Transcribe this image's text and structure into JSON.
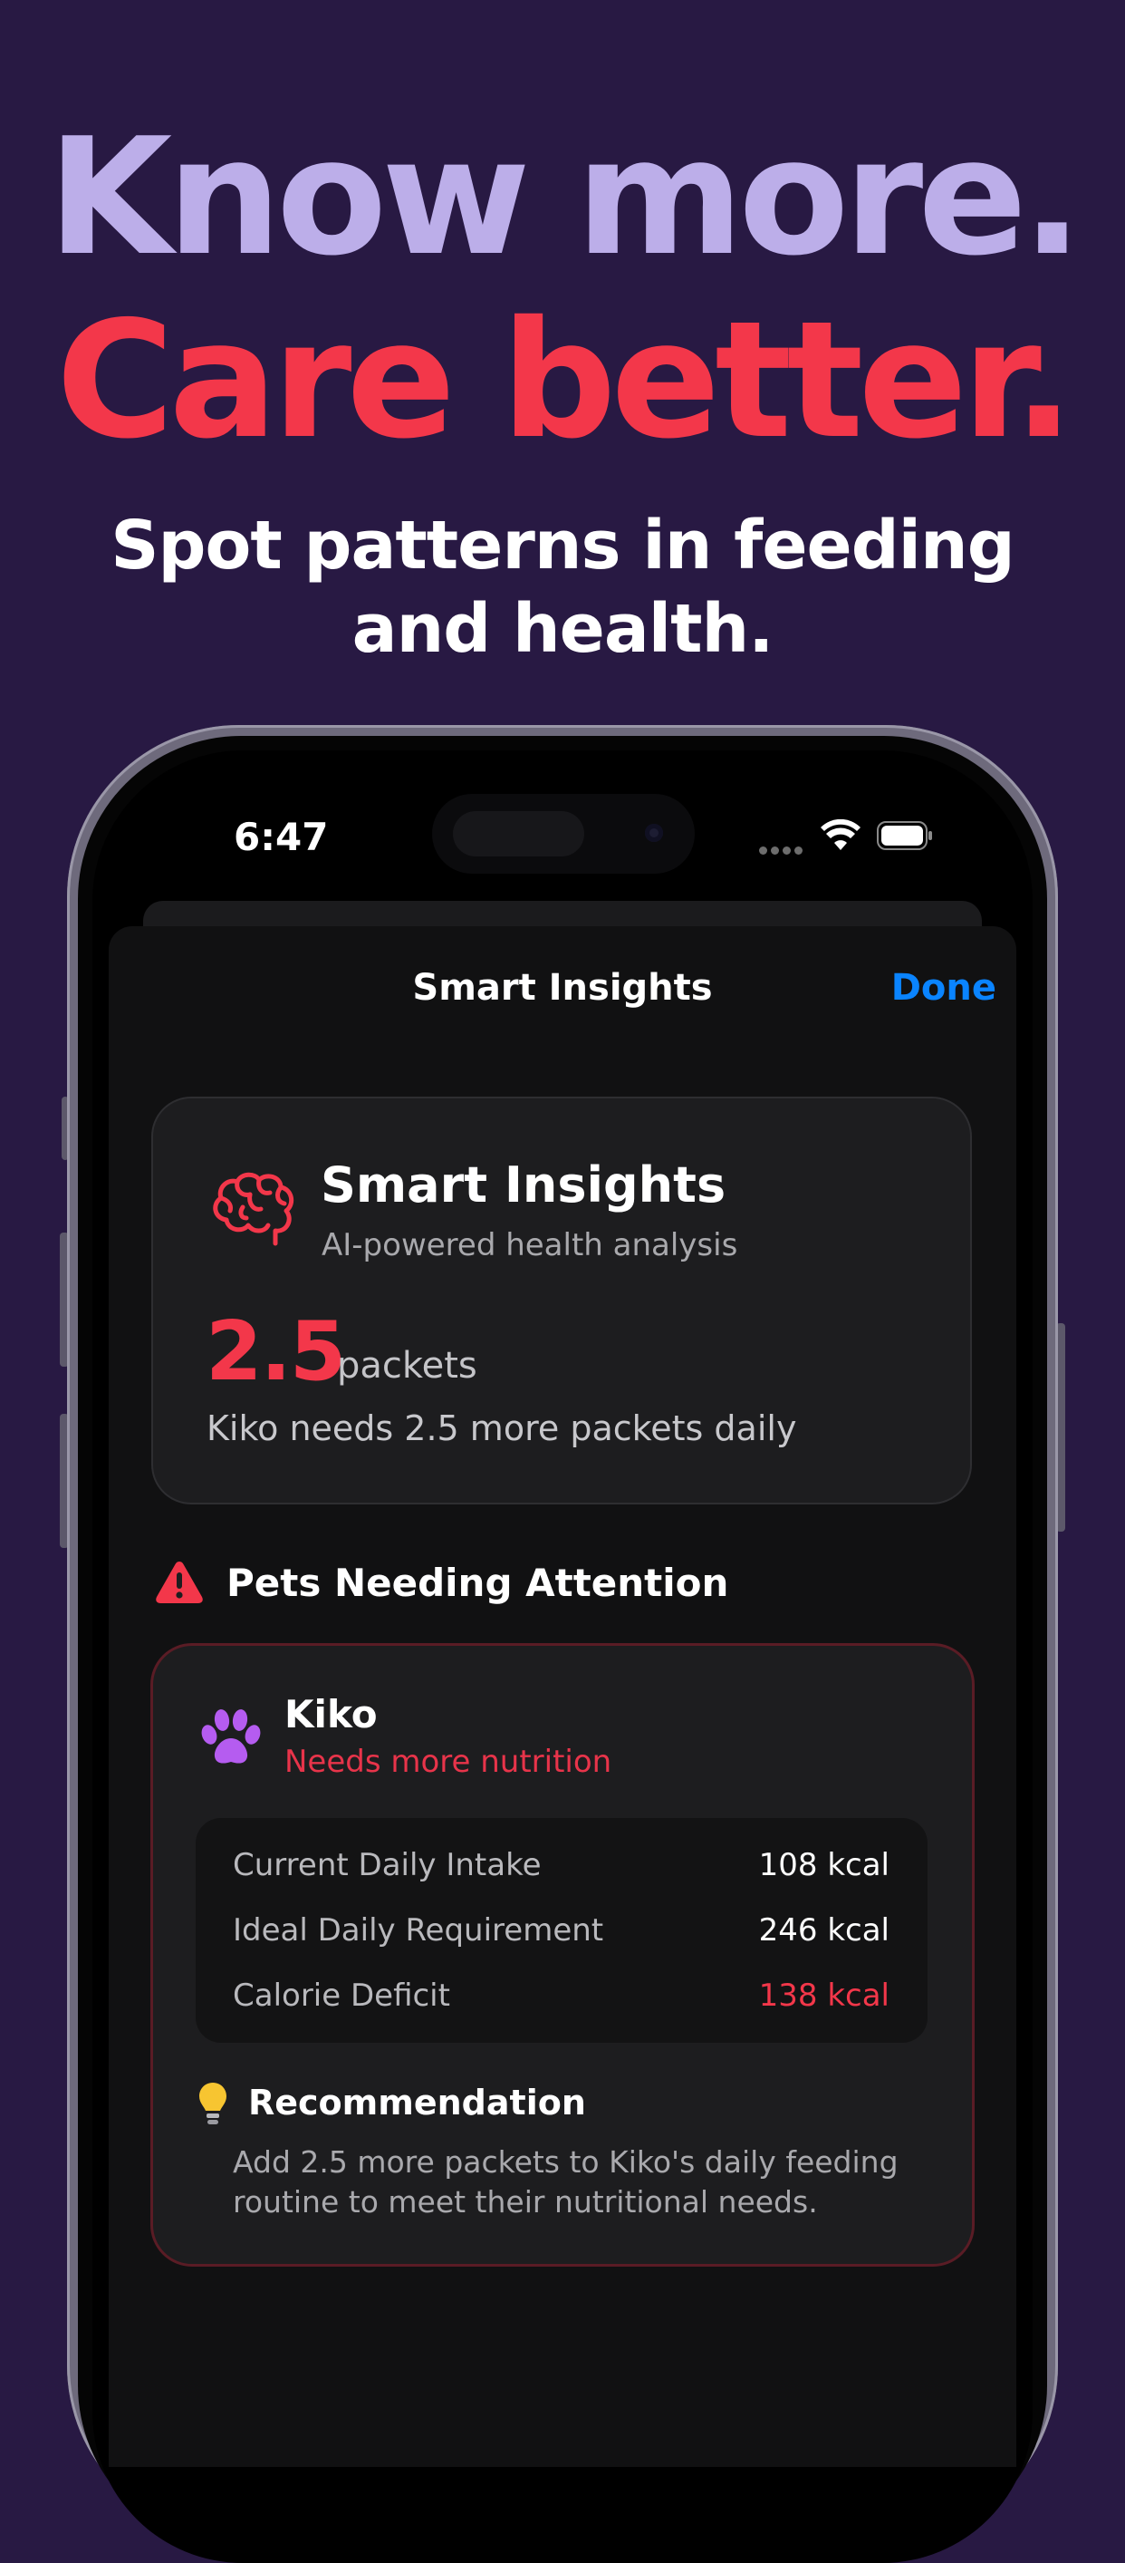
{
  "hero": {
    "line1": "Know more.",
    "line2": "Care better.",
    "subtitle": "Spot patterns in feeding and health."
  },
  "colors": {
    "background": "#281943",
    "headline_light": "#bcaee9",
    "accent_red": "#f3374a",
    "ios_blue": "#0a84ff"
  },
  "status_bar": {
    "time": "6:47"
  },
  "nav": {
    "title": "Smart Insights",
    "done_label": "Done"
  },
  "insight_card": {
    "icon": "brain-icon",
    "title": "Smart Insights",
    "subtitle": "AI-powered health analysis",
    "value": "2.5",
    "unit": "packets",
    "description": "Kiko needs 2.5 more packets daily"
  },
  "attention": {
    "icon": "warning-icon",
    "title": "Pets Needing Attention",
    "pet": {
      "icon": "paw-icon",
      "name": "Kiko",
      "status": "Needs more nutrition",
      "stats": [
        {
          "label": "Current Daily Intake",
          "value": "108 kcal"
        },
        {
          "label": "Ideal Daily Requirement",
          "value": "246 kcal"
        },
        {
          "label": "Calorie Deficit",
          "value": "138 kcal"
        }
      ],
      "recommendation": {
        "icon": "lightbulb-icon",
        "title": "Recommendation",
        "body": "Add 2.5 more packets to Kiko's daily feeding routine to meet their nutritional needs."
      }
    }
  }
}
